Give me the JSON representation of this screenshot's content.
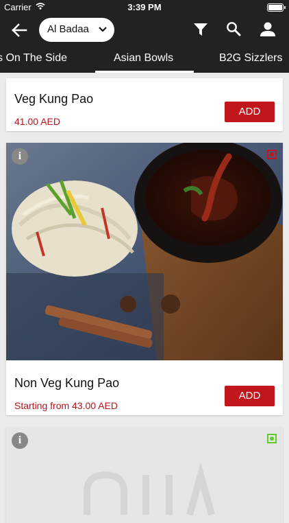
{
  "status_bar": {
    "carrier": "Carrier",
    "time": "3:39 PM"
  },
  "nav": {
    "branch": "Al Badaa"
  },
  "tabs": [
    {
      "label": "s On The Side"
    },
    {
      "label": "Asian Bowls",
      "active": true
    },
    {
      "label": "B2G Sizzlers"
    }
  ],
  "items": [
    {
      "name": "Veg Kung Pao",
      "price": "41.00 AED",
      "button": "ADD"
    },
    {
      "name": "Non Veg Kung Pao",
      "price": "Starting from 43.00 AED",
      "button": "ADD"
    },
    {
      "name": "",
      "price": "",
      "button": ""
    }
  ],
  "icons": [
    "back-arrow-icon",
    "chevron-down-icon",
    "filter-icon",
    "search-icon",
    "user-icon",
    "info-icon",
    "non-veg-icon",
    "veg-icon",
    "wifi-icon",
    "battery-icon"
  ],
  "colors": {
    "header": "#222222",
    "accent": "#c3161c",
    "price": "#b8141c",
    "non_veg": "#c3161c",
    "veg": "#5fcb2a"
  }
}
